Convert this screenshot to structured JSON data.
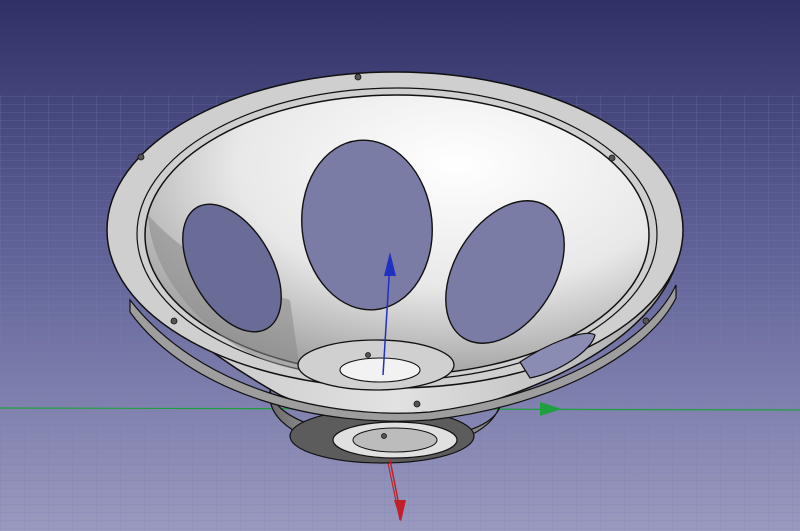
{
  "viewport": {
    "kind": "3d-cad-viewport",
    "object": "loudspeaker-frame-basket",
    "background_top": "#2f3166",
    "background_bottom": "#8f8fb8",
    "grid_color": "#6e7aa8",
    "part_color": "#d8d8d8",
    "edge_color": "#111111"
  },
  "axes": {
    "x_color": "#c0202a",
    "y_color": "#20b040",
    "z_color": "#2030c0"
  }
}
